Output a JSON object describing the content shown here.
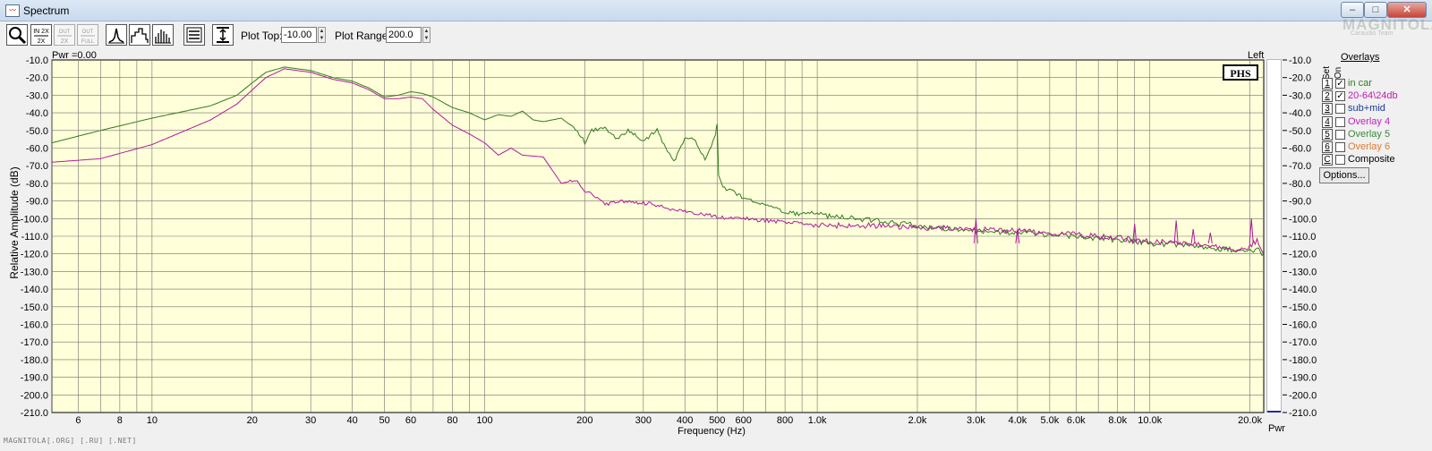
{
  "window": {
    "title": "Spectrum",
    "minimize_glyph": "‒",
    "maximize_glyph": "□",
    "close_glyph": "✕",
    "watermark_brand": "MAGNITOLA",
    "watermark_team": "Caraudio Team"
  },
  "toolbar": {
    "buttons": [
      "zoom-icon",
      "zoom-in-2x-icon",
      "zoom-out-2x-icon",
      "zoom-out-full-icon",
      "line-graph-icon",
      "bar-graph-icon",
      "octave-bars-icon",
      "settings-icon",
      "fit-range-icon"
    ],
    "zoom_in_label": "IN 2X",
    "zoom_out_label": "OUT 2X",
    "zoom_full_label": "OUT FULL",
    "plot_top_label": "Plot Top:",
    "plot_top_value": "-10.00",
    "plot_range_label": "Plot Range:",
    "plot_range_value": "200.0"
  },
  "graph": {
    "pwr_left": "Pwr =0.00",
    "channel": "Left",
    "ylabel": "Relative Amplitude (dB)",
    "xlabel": "Frequency (Hz)",
    "pwr_right": "Pwr",
    "logo_text": "PHS",
    "background_color": "#ffffd9",
    "grid_color": "#707070"
  },
  "chart_data": {
    "type": "line",
    "xlabel": "Frequency (Hz)",
    "ylabel": "Relative Amplitude (dB)",
    "xscale": "log",
    "xlim": [
      5,
      22000
    ],
    "ylim": [
      -210,
      -10
    ],
    "y_ticks": [
      "-10.0",
      "-20.0",
      "-30.0",
      "-40.0",
      "-50.0",
      "-60.0",
      "-70.0",
      "-80.0",
      "-90.0",
      "-100.0",
      "-110.0",
      "-120.0",
      "-130.0",
      "-140.0",
      "-150.0",
      "-160.0",
      "-170.0",
      "-180.0",
      "-190.0",
      "-200.0",
      "-210.0"
    ],
    "x_ticks": [
      {
        "v": 6,
        "t": "6"
      },
      {
        "v": 8,
        "t": "8"
      },
      {
        "v": 10,
        "t": "10"
      },
      {
        "v": 20,
        "t": "20"
      },
      {
        "v": 30,
        "t": "30"
      },
      {
        "v": 40,
        "t": "40"
      },
      {
        "v": 50,
        "t": "50"
      },
      {
        "v": 60,
        "t": "60"
      },
      {
        "v": 80,
        "t": "80"
      },
      {
        "v": 100,
        "t": "100"
      },
      {
        "v": 200,
        "t": "200"
      },
      {
        "v": 300,
        "t": "300"
      },
      {
        "v": 400,
        "t": "400"
      },
      {
        "v": 500,
        "t": "500"
      },
      {
        "v": 600,
        "t": "600"
      },
      {
        "v": 800,
        "t": "800"
      },
      {
        "v": 1000,
        "t": "1.0k"
      },
      {
        "v": 2000,
        "t": "2.0k"
      },
      {
        "v": 3000,
        "t": "3.0k"
      },
      {
        "v": 4000,
        "t": "4.0k"
      },
      {
        "v": 5000,
        "t": "5.0k"
      },
      {
        "v": 6000,
        "t": "6.0k"
      },
      {
        "v": 8000,
        "t": "8.0k"
      },
      {
        "v": 10000,
        "t": "10.0k"
      },
      {
        "v": 20000,
        "t": "20.0k"
      }
    ],
    "series": [
      {
        "name": "in car",
        "color": "#2e7d1f",
        "x": [
          5,
          7,
          10,
          15,
          18,
          20,
          22,
          25,
          30,
          35,
          40,
          45,
          50,
          55,
          60,
          65,
          70,
          80,
          90,
          100,
          110,
          120,
          130,
          140,
          150,
          170,
          190,
          200,
          210,
          230,
          250,
          270,
          300,
          330,
          350,
          370,
          400,
          430,
          460,
          480,
          495,
          500,
          505,
          520,
          560,
          600,
          700,
          800,
          900,
          950,
          1000,
          1100,
          1300,
          1600,
          2000,
          2500,
          3000,
          3500,
          4000,
          5000,
          6000,
          7000,
          8000,
          9000,
          10000,
          12000,
          14000,
          16000,
          18000,
          20000,
          21000,
          22000
        ],
        "y": [
          -57,
          -50,
          -43,
          -36,
          -30,
          -23,
          -17,
          -14,
          -16,
          -20,
          -22,
          -26,
          -31,
          -30,
          -28,
          -29,
          -31,
          -37,
          -40,
          -44,
          -41,
          -42,
          -39,
          -44,
          -45,
          -43,
          -50,
          -57,
          -50,
          -48,
          -55,
          -50,
          -56,
          -50,
          -60,
          -68,
          -55,
          -55,
          -67,
          -60,
          -52,
          -46,
          -75,
          -82,
          -85,
          -88,
          -92,
          -96,
          -98,
          -96,
          -97,
          -99,
          -100,
          -102,
          -104,
          -106,
          -107,
          -108,
          -108,
          -109,
          -110,
          -111,
          -112,
          -113,
          -114,
          -115,
          -116,
          -117,
          -118,
          -118,
          -117,
          -120
        ]
      },
      {
        "name": "20-64\\24db",
        "color": "#b01a9c",
        "x": [
          5,
          7,
          10,
          15,
          18,
          20,
          22,
          25,
          30,
          35,
          40,
          45,
          50,
          55,
          60,
          65,
          70,
          80,
          90,
          100,
          110,
          120,
          130,
          150,
          170,
          190,
          200,
          210,
          230,
          250,
          300,
          400,
          500,
          600,
          800,
          1000,
          1500,
          2000,
          3000,
          4000,
          5000,
          6000,
          7000,
          8000,
          9000,
          10000,
          12000,
          14000,
          16000,
          18000,
          20000,
          21000,
          22000
        ],
        "y": [
          -68,
          -66,
          -58,
          -44,
          -35,
          -27,
          -20,
          -15,
          -17,
          -21,
          -23,
          -27,
          -32,
          -32,
          -31,
          -32,
          -38,
          -47,
          -52,
          -57,
          -64,
          -60,
          -64,
          -65,
          -80,
          -78,
          -84,
          -86,
          -92,
          -90,
          -91,
          -96,
          -99,
          -100,
          -102,
          -104,
          -104,
          -105,
          -106,
          -107,
          -108,
          -109,
          -110,
          -111,
          -112,
          -113,
          -114,
          -115,
          -116,
          -117,
          -116,
          -112,
          -120
        ]
      }
    ],
    "peaks": [
      {
        "x": 3000,
        "y": -100
      },
      {
        "x": 4000,
        "y": -106
      },
      {
        "x": 9000,
        "y": -103
      },
      {
        "x": 12000,
        "y": -101
      },
      {
        "x": 13500,
        "y": -106
      },
      {
        "x": 15200,
        "y": -108
      },
      {
        "x": 20200,
        "y": -100
      }
    ]
  },
  "overlays": {
    "title": "Overlays",
    "hdr_set": "Set",
    "hdr_on": "On",
    "items": [
      {
        "num": "1",
        "checked": "✓",
        "label": "in car",
        "color": "#2e7d1f"
      },
      {
        "num": "2",
        "checked": "✓",
        "label": "20-64\\24db",
        "color": "#c41ab0"
      },
      {
        "num": "3",
        "checked": "",
        "label": "sub+mid",
        "color": "#1a3a9c"
      },
      {
        "num": "4",
        "checked": "",
        "label": "Overlay 4",
        "color": "#c020c0"
      },
      {
        "num": "5",
        "checked": "",
        "label": "Overlay 5",
        "color": "#3a8a3a"
      },
      {
        "num": "6",
        "checked": "",
        "label": "Overlay 6",
        "color": "#e07a30"
      },
      {
        "num": "C",
        "checked": "",
        "label": "Composite",
        "color": "#000000"
      }
    ],
    "options_label": "Options..."
  },
  "status": {
    "text": "MAGNITOLA[.ORG] [.RU] [.NET]"
  }
}
